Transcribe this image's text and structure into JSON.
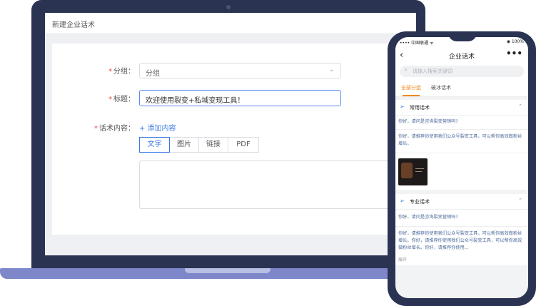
{
  "laptop": {
    "page_title": "新建企业话术",
    "form": {
      "group_label": "分组",
      "group_value": "分组",
      "title_label": "标题",
      "title_value": "欢迎使用裂变+私域变现工具！",
      "content_label": "话术内容",
      "label_suffix": "：",
      "required_mark": "*",
      "add_content_link": "+ 添加内容",
      "tabs": [
        {
          "label": "文字",
          "active": true
        },
        {
          "label": "图片",
          "active": false
        },
        {
          "label": "链接",
          "active": false
        },
        {
          "label": "PDF",
          "active": false
        }
      ]
    }
  },
  "phone": {
    "status_left": "•••• 中国联通 ᯤ",
    "status_right": "◉ 100%",
    "nav_title": "企业话术",
    "back_icon": "‹",
    "more_icon": "•••",
    "search_placeholder": "请输入搜索关键词",
    "tabs": [
      "全部分组",
      "破冰话术"
    ],
    "sections": [
      {
        "title": "常用话术",
        "messages": [
          "你好，请问是咨询裂变营销吗?",
          "你好，请推荐你使用我们公众号裂变工具，可以帮你高效做粉丝增长。"
        ]
      },
      {
        "title": "专业话术",
        "messages": [
          "你好，请问是咨询裂变营销吗?",
          "你好，请推荐你使用我们公众号裂变工具，可以帮你高效做粉丝增长。你好，请推荐你使用我们公众号裂变工具，可以帮你高效做粉丝增长。你好，请推荐你使用..."
        ],
        "expand_label": "展开"
      }
    ]
  },
  "colors": {
    "accent_blue": "#3a7ae0",
    "accent_orange": "#f08a1c",
    "required_red": "#e64a4a",
    "device_navy": "#2b3352",
    "laptop_base": "#7d87c9"
  }
}
